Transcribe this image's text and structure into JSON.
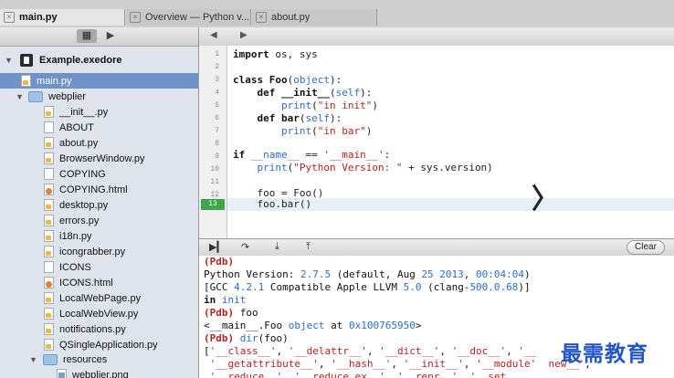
{
  "tabs": [
    {
      "label": "main.py"
    },
    {
      "label": "Overview — Python v..."
    },
    {
      "label": "about.py"
    }
  ],
  "sidebar": {
    "project": "Example.exedore",
    "selected_file": "main.py",
    "folder_name": "webplier",
    "files": [
      {
        "name": "__init__.py",
        "type": "py"
      },
      {
        "name": "ABOUT",
        "type": "txt"
      },
      {
        "name": "about.py",
        "type": "py"
      },
      {
        "name": "BrowserWindow.py",
        "type": "py"
      },
      {
        "name": "COPYING",
        "type": "txt"
      },
      {
        "name": "COPYING.html",
        "type": "html"
      },
      {
        "name": "desktop.py",
        "type": "py"
      },
      {
        "name": "errors.py",
        "type": "py"
      },
      {
        "name": "i18n.py",
        "type": "py"
      },
      {
        "name": "icongrabber.py",
        "type": "py"
      },
      {
        "name": "ICONS",
        "type": "txt"
      },
      {
        "name": "ICONS.html",
        "type": "html"
      },
      {
        "name": "LocalWebPage.py",
        "type": "py"
      },
      {
        "name": "LocalWebView.py",
        "type": "py"
      },
      {
        "name": "notifications.py",
        "type": "py"
      },
      {
        "name": "QSingleApplication.py",
        "type": "py"
      }
    ],
    "subfolder": "resources",
    "subfolder_file": "webplier.png"
  },
  "editor": {
    "current_line": "13",
    "line_numbers": [
      "1",
      "2",
      "3",
      "4",
      "5",
      "6",
      "7",
      "8",
      "9",
      "10",
      "11",
      "12",
      "13"
    ]
  },
  "debug": {
    "clear_label": "Clear"
  },
  "watermark": "最需教育"
}
